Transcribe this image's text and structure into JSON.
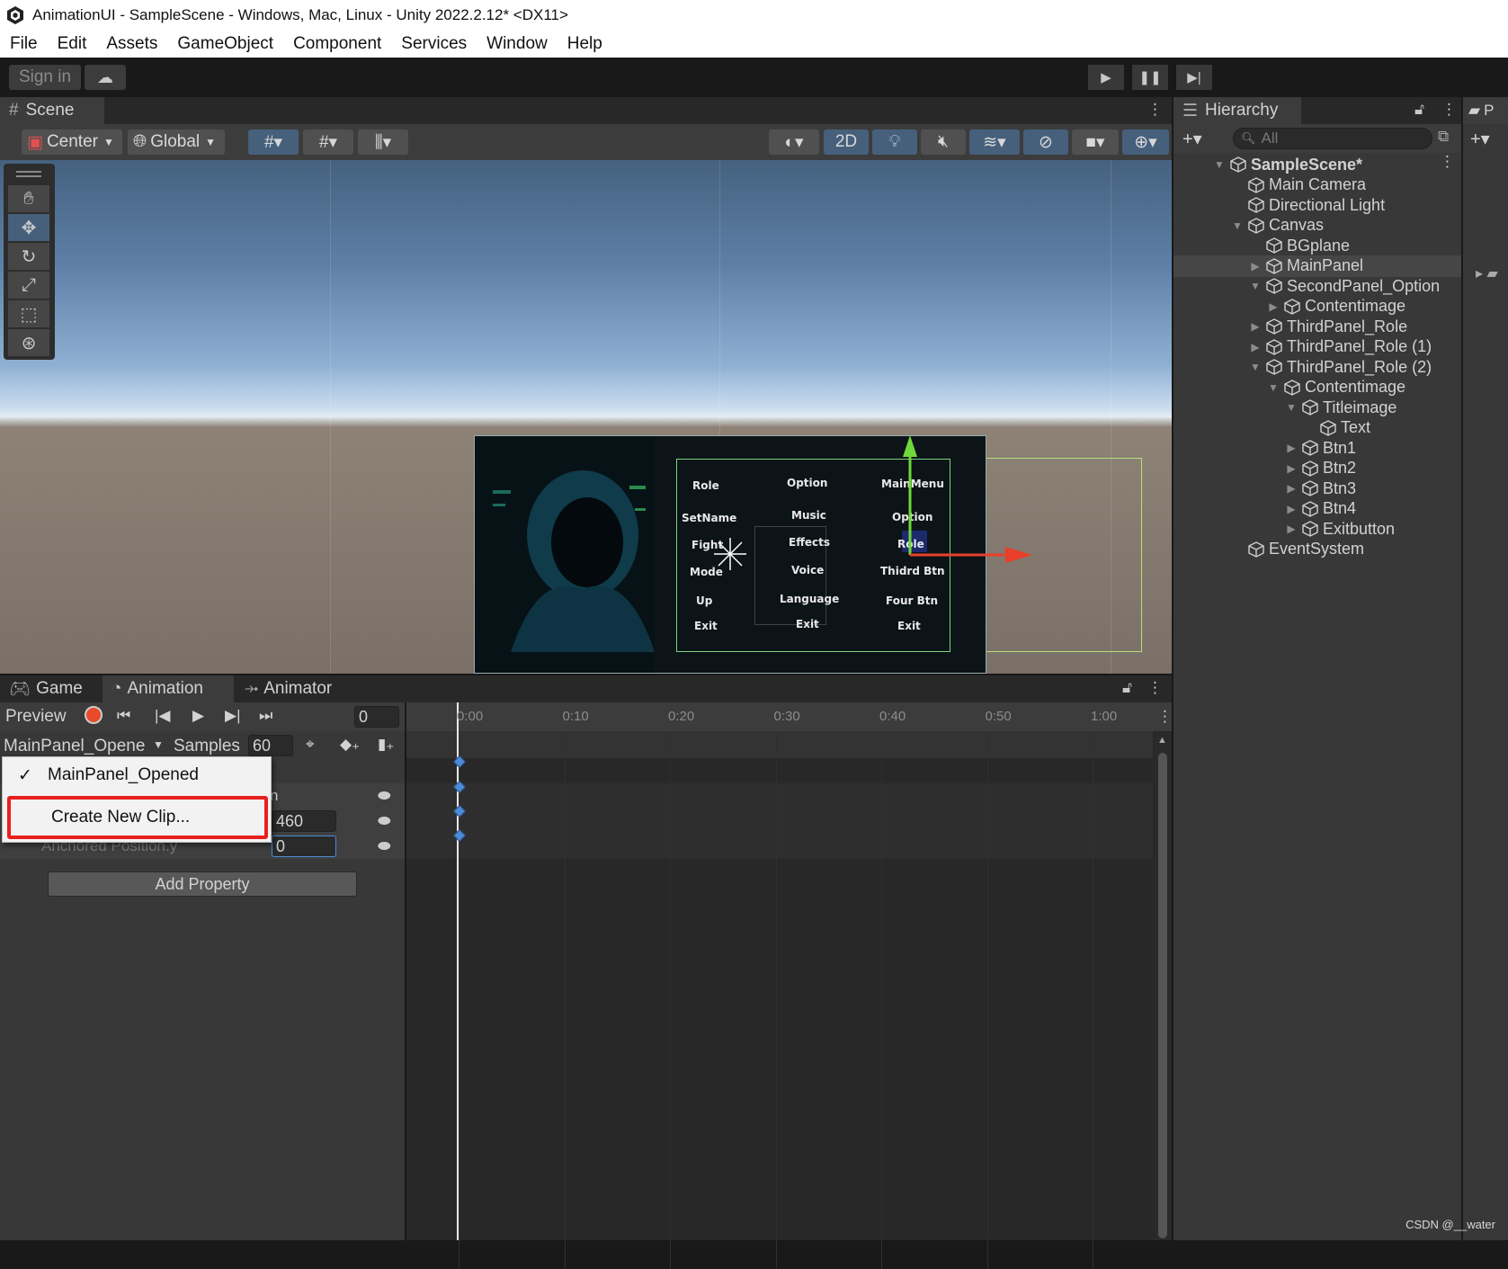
{
  "window": {
    "title": "AnimationUI - SampleScene - Windows, Mac, Linux - Unity 2022.2.12* <DX11>"
  },
  "menu": [
    "File",
    "Edit",
    "Assets",
    "GameObject",
    "Component",
    "Services",
    "Window",
    "Help"
  ],
  "toolbar": {
    "sign_in": "Sign in"
  },
  "scene": {
    "tab_label": "Scene",
    "pivot": "Center",
    "space": "Global",
    "toggle_2d": "2D"
  },
  "canvas_ui": {
    "col1": [
      "Role",
      "SetName",
      "Fight",
      "Mode",
      "Up",
      "Exit"
    ],
    "col2": [
      "Option",
      "Music",
      "Effects",
      "Voice",
      "Language",
      "Exit"
    ],
    "col3": [
      "MainMenu",
      "Option",
      "Role",
      "Thidrd Btn",
      "Four Btn",
      "Exit"
    ]
  },
  "hierarchy": {
    "tab_label": "Hierarchy",
    "search_placeholder": "All",
    "items": [
      {
        "label": "SampleScene*",
        "depth": 0,
        "arrow": "down",
        "bold": true
      },
      {
        "label": "Main Camera",
        "depth": 1,
        "arrow": ""
      },
      {
        "label": "Directional Light",
        "depth": 1,
        "arrow": ""
      },
      {
        "label": "Canvas",
        "depth": 1,
        "arrow": "down"
      },
      {
        "label": "BGplane",
        "depth": 2,
        "arrow": ""
      },
      {
        "label": "MainPanel",
        "depth": 2,
        "arrow": "right",
        "selected": true
      },
      {
        "label": "SecondPanel_Option",
        "depth": 2,
        "arrow": "down"
      },
      {
        "label": "Contentimage",
        "depth": 3,
        "arrow": "right"
      },
      {
        "label": "ThirdPanel_Role",
        "depth": 2,
        "arrow": "right"
      },
      {
        "label": "ThirdPanel_Role (1)",
        "depth": 2,
        "arrow": "right"
      },
      {
        "label": "ThirdPanel_Role (2)",
        "depth": 2,
        "arrow": "down"
      },
      {
        "label": "Contentimage",
        "depth": 3,
        "arrow": "down"
      },
      {
        "label": "Titleimage",
        "depth": 4,
        "arrow": "down"
      },
      {
        "label": "Text",
        "depth": 5,
        "arrow": ""
      },
      {
        "label": "Btn1",
        "depth": 4,
        "arrow": "right"
      },
      {
        "label": "Btn2",
        "depth": 4,
        "arrow": "right"
      },
      {
        "label": "Btn3",
        "depth": 4,
        "arrow": "right"
      },
      {
        "label": "Btn4",
        "depth": 4,
        "arrow": "right"
      },
      {
        "label": "Exitbutton",
        "depth": 4,
        "arrow": "right"
      },
      {
        "label": "EventSystem",
        "depth": 1,
        "arrow": ""
      }
    ]
  },
  "project_tab_label": "P",
  "animation": {
    "tabs": [
      "Game",
      "Animation",
      "Animator"
    ],
    "preview_label": "Preview",
    "frame_value": "0",
    "clip_name": "MainPanel_Opene",
    "samples_label": "Samples",
    "samples_value": "60",
    "ruler": [
      "0:00",
      "0:10",
      "0:20",
      "0:30",
      "0:40",
      "0:50",
      "1:00"
    ],
    "property_partial": "n",
    "property_value_x": "460",
    "property_label_y": "Anchored Position.y",
    "property_value_y": "0",
    "add_property": "Add Property",
    "dropdown": {
      "checked_clip": "MainPanel_Opened",
      "create_new": "Create New Clip..."
    }
  },
  "watermark": "CSDN @__water",
  "colors": {
    "highlight_red": "#e8201d",
    "key_blue": "#4d8bd9",
    "selection_blue": "#46607c"
  }
}
